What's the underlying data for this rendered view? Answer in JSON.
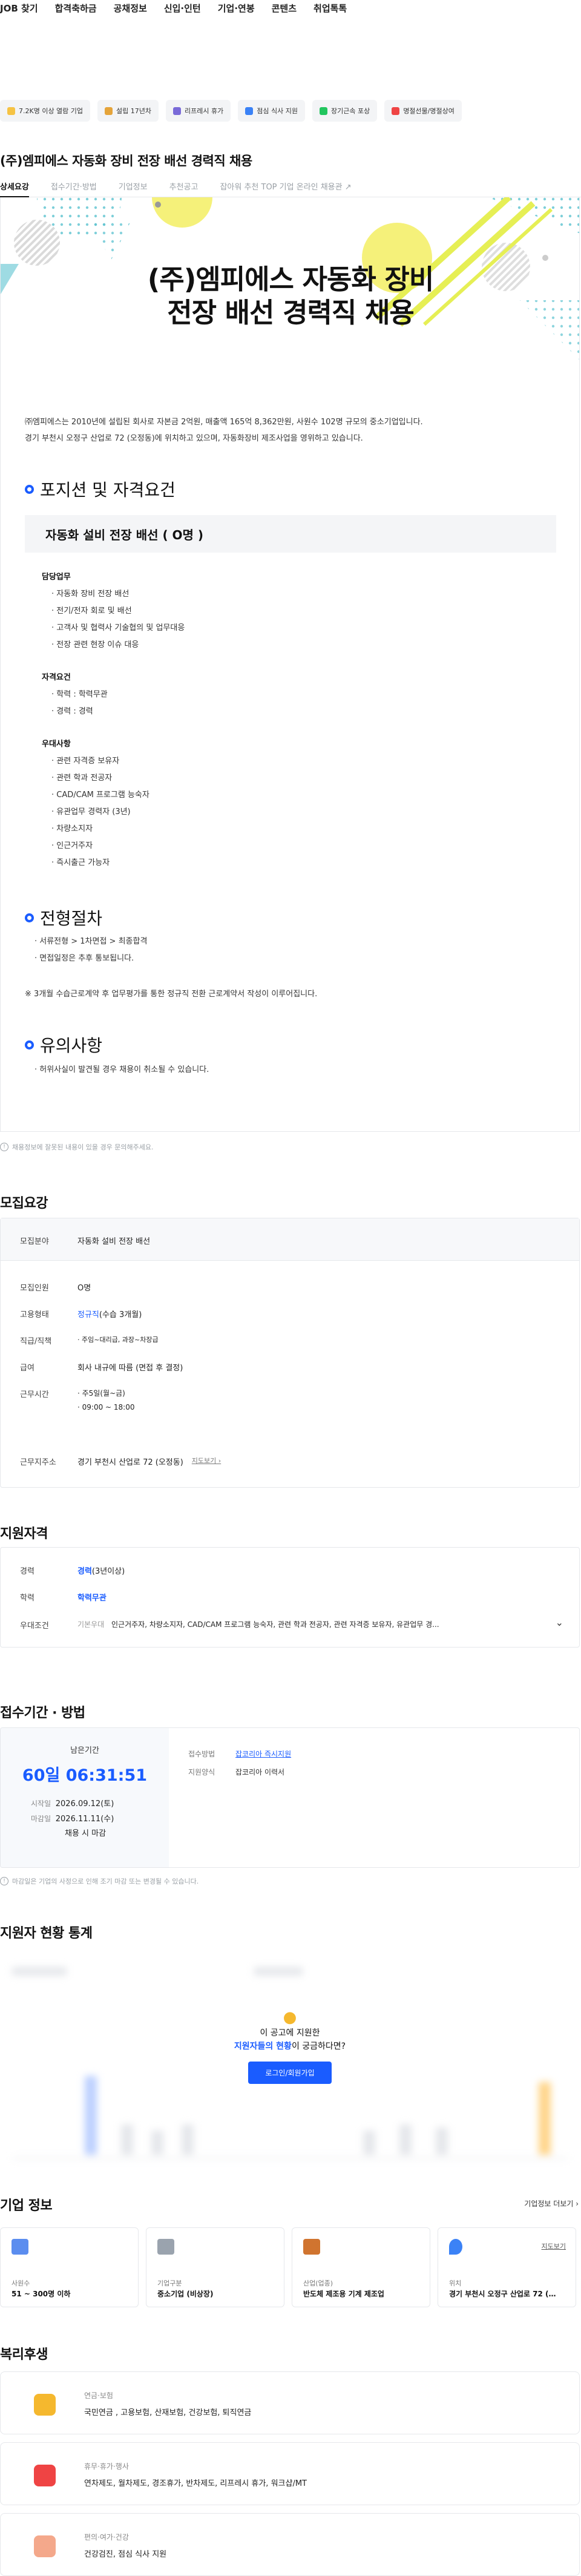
{
  "nav": [
    "JOB 찾기",
    "합격축하금",
    "공채정보",
    "신입·인턴",
    "기업·연봉",
    "콘텐츠",
    "취업톡톡"
  ],
  "badges": [
    {
      "label": "7.2K명 이상 열람 기업",
      "color": "#f6c344"
    },
    {
      "label": "설립 17년차",
      "color": "#e5a43a"
    },
    {
      "label": "리프레시 휴가",
      "color": "#7a6ad8"
    },
    {
      "label": "점심 식사 지원",
      "color": "#3b82f6"
    },
    {
      "label": "장기근속 포상",
      "color": "#22c55e"
    },
    {
      "label": "명절선물/명절상여",
      "color": "#ef4444"
    }
  ],
  "job_title": "(주)엠피에스 자동화 장비 전장 배선 경력직 채용",
  "tabs": [
    "상세요강",
    "접수기간·방법",
    "기업정보",
    "추천공고",
    "잡아워 추천 TOP 기업 온라인 채용관 ↗"
  ],
  "poster": {
    "title_line1": "(주)엠피에스 자동화 장비",
    "title_line2": "전장 배선 경력직 채용",
    "intro_line1": "㈜엠피에스는 2010년에 설립된 회사로 자본금 2억원, 매출액 165억 8,362만원, 사원수 102명 규모의 중소기업입니다.",
    "intro_line2": "경기 부천시 오정구 산업로 72 (오정동)에 위치하고 있으며, 자동화장비 제조사업을 영위하고 있습니다.",
    "section1": "포지션 및 자격요건",
    "position_header": "자동화 설비 전장 배선 ( O명 )",
    "duties_title": "담당업무",
    "duties": [
      "· 자동화 장비 전장 배선",
      "· 전기/전자 회로 및 배선",
      "· 고객사 및 협력사 기술협의 및 업무대응",
      "· 전장 관련 현장 이슈 대응"
    ],
    "qual_title": "자격요건",
    "quals": [
      "· 학력 : 학력무관",
      "· 경력 : 경력"
    ],
    "pref_title": "우대사항",
    "prefs": [
      "· 관련 자격증 보유자",
      "· 관련 학과 전공자",
      "· CAD/CAM 프로그램 능숙자",
      "· 유관업무 경력자 (3년)",
      "· 차량소지자",
      "· 인근거주자",
      "· 즉시출근 가능자"
    ],
    "section2": "전형절차",
    "process": "· 서류전형 > 1차면접 > 최종합격",
    "process_note": "· 면접일정은 추후 통보됩니다.",
    "contract_note": "※ 3개월 수습근로계약 후 업무평가를 통한 정규직 전환 근로계약서 작성이 이루어집니다.",
    "section3": "유의사항",
    "caution": "· 허위사실이 발견될 경우 채용이 취소될 수 있습니다."
  },
  "notice_text": "채용정보에 잘못된 내용이 있을 경우 문의해주세요.",
  "recruit": {
    "heading": "모집요강",
    "rows": [
      {
        "k": "모집분야",
        "v": "자동화 설비 전장 배선"
      },
      {
        "k": "모집인원",
        "v": "O명"
      },
      {
        "k": "고용형태",
        "v": "정규직",
        "v2": "(수습 3개월)"
      },
      {
        "k": "직급/직책",
        "v": "· 주임~대리급, 과장~차장급"
      },
      {
        "k": "급여",
        "v": "회사 내규에 따름 (면접 후 결정)"
      },
      {
        "k": "근무시간",
        "v": "· 주5일(월~금)",
        "v2": "· 09:00 ~ 18:00"
      },
      {
        "k": "근무지주소",
        "v": "경기 부천시 산업로 72 (오정동)",
        "v2": "지도보기 ›"
      }
    ]
  },
  "apply": {
    "heading": "지원자격",
    "rows": [
      {
        "k": "경력",
        "v": "경력",
        "v2": "(3년이상)"
      },
      {
        "k": "학력",
        "v": "학력무관"
      },
      {
        "k": "우대조건",
        "v": "기본우대",
        "v2": "인근거주자, 차량소지자, CAD/CAM 프로그램 능숙자, 관련 학과 전공자, 관련 자격증 보유자, 유관업무 경..."
      }
    ]
  },
  "period": {
    "heading": "접수기간 · 방법",
    "remain_label": "남은기간",
    "remain": "60일 06:31:51",
    "start_label": "시작일",
    "start": "2026.09.12(토)",
    "end_label": "마감일",
    "end": "2026.11.11(수)",
    "end_note": "채용 시 마감",
    "method_label": "접수방법",
    "method": "잡코리아 즉시지원",
    "form_label": "지원양식",
    "form": "잡코리아 이력서",
    "note": "마감일은 기업의 사정으로 인해 조기 마감 또는 변경될 수 있습니다."
  },
  "stats": {
    "heading": "지원자 현황 통계",
    "question_line1": "이 공고에 지원한",
    "question_highlight": "지원자들의 현황",
    "question_line2": "이 궁금하다면?",
    "button": "로그인/회원가입"
  },
  "company": {
    "heading": "기업 정보",
    "more": "기업정보 더보기 ›",
    "cards": [
      {
        "label": "사원수",
        "value": "51 ~ 300명 이하",
        "color": "#5b8def"
      },
      {
        "label": "기업구분",
        "value": "중소기업 (비상장)",
        "color": "#9aa3ae"
      },
      {
        "label": "산업(업종)",
        "value": "반도체 제조용 기계 제조업",
        "color": "#d0742f"
      },
      {
        "label": "위치",
        "value": "경기 부천시 오정구 산업로 72 (…",
        "color": "#3b82f6",
        "more": "지도보기"
      }
    ]
  },
  "welfare": {
    "heading": "복리후생",
    "items": [
      {
        "title": "연금·보험",
        "value": "국민연금 , 고용보험, 산재보험, 건강보험, 퇴직연금",
        "color": "#f5b82e"
      },
      {
        "title": "휴무·휴가·행사",
        "value": "연차제도, 월차제도, 경조휴가, 반차제도, 리프레시 휴가, 워크샵/MT",
        "color": "#ef4444"
      },
      {
        "title": "편의·여가·건강",
        "value": "건강검진, 점심 식사 지원",
        "color": "#f4a88b"
      }
    ]
  }
}
